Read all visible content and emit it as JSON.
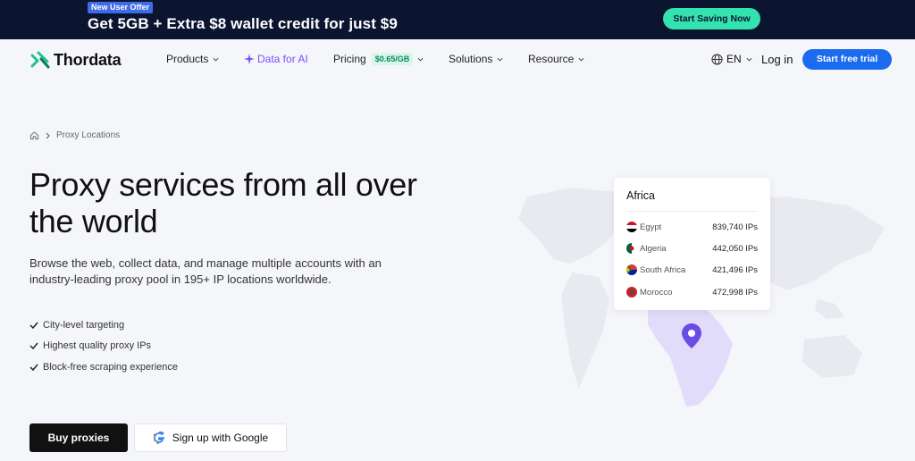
{
  "promo": {
    "badge": "New User Offer",
    "headline": "Get 5GB + Extra $8 wallet credit for just $9",
    "cta": "Start Saving Now"
  },
  "nav": {
    "logo": "Thordata",
    "products": "Products",
    "data_ai": "Data for AI",
    "pricing": "Pricing",
    "pricing_badge": "$0.65/GB",
    "solutions": "Solutions",
    "resource": "Resource",
    "lang": "EN",
    "login": "Log in",
    "trial": "Start free trial"
  },
  "breadcrumb": {
    "current": "Proxy Locations"
  },
  "hero": {
    "title": "Proxy services from all over the world",
    "description": "Browse the web, collect data, and manage multiple accounts with an industry-leading proxy pool in 195+ IP locations worldwide.",
    "features": [
      "City-level targeting",
      "Highest quality proxy IPs",
      "Block-free scraping experience"
    ],
    "buy_label": "Buy proxies",
    "google_label": "Sign up with Google"
  },
  "region_card": {
    "title": "Africa",
    "rows": [
      {
        "country": "Egypt",
        "count": "839,740 IPs"
      },
      {
        "country": "Algeria",
        "count": "442,050 IPs"
      },
      {
        "country": "South Africa",
        "count": "421,496 IPs"
      },
      {
        "country": "Morocco",
        "count": "472,998 IPs"
      }
    ]
  },
  "colors": {
    "promo_bg": "#0b1530",
    "promo_cta": "#34e2b0",
    "primary": "#1a6bf0",
    "ai_accent": "#7c4dff",
    "pin": "#6b4de6",
    "highlight_region": "#e2dcfb"
  }
}
